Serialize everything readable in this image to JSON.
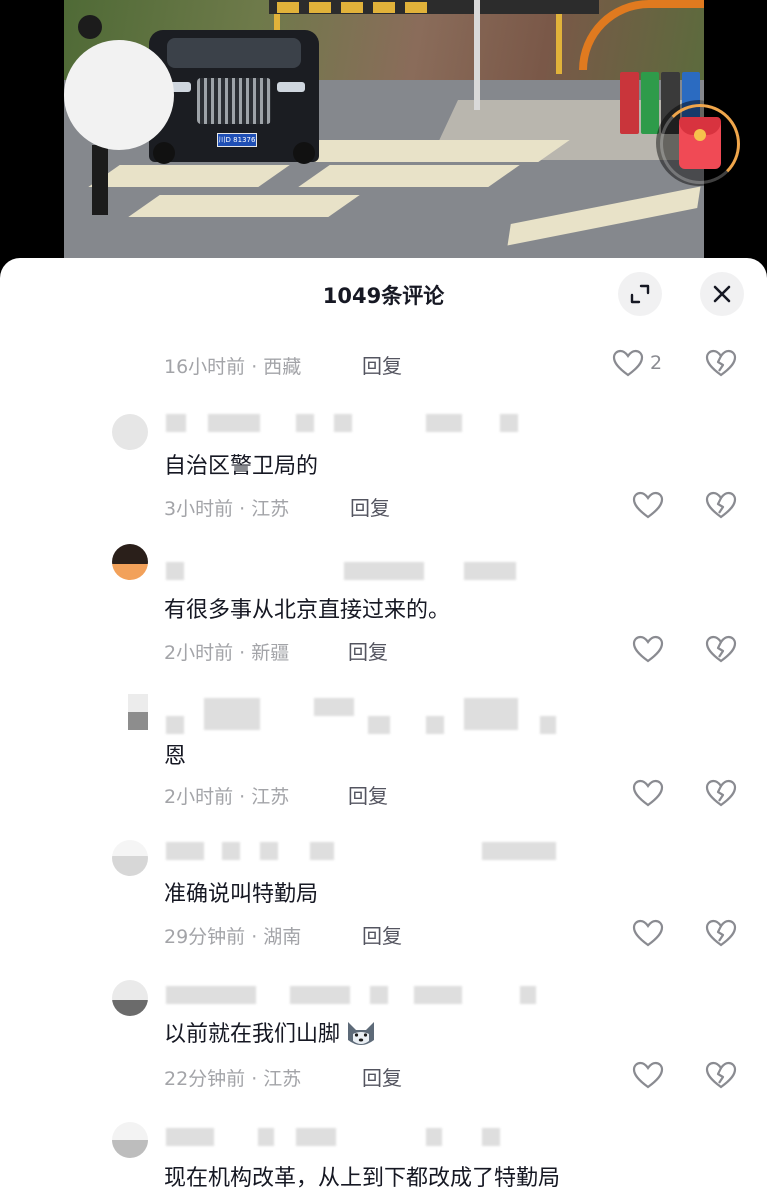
{
  "video": {
    "plate_text": "川D 81376"
  },
  "sheet": {
    "title": "1049条评论"
  },
  "comments": [
    {
      "text": "",
      "meta": "16小时前 · 西藏",
      "reply": "回复",
      "likes": "2"
    },
    {
      "text": "自治区警卫局的",
      "meta": "3小时前 · 江苏",
      "reply": "回复",
      "likes": ""
    },
    {
      "text": "有很多事从北京直接过来的。",
      "meta": "2小时前 · 新疆",
      "reply": "回复",
      "likes": ""
    },
    {
      "text": "恩",
      "meta": "2小时前 · 江苏",
      "reply": "回复",
      "likes": ""
    },
    {
      "text": "准确说叫特勤局",
      "meta": "29分钟前 · 湖南",
      "reply": "回复",
      "likes": ""
    },
    {
      "text": "以前就在我们山脚",
      "meta": "22分钟前 · 江苏",
      "reply": "回复",
      "likes": "",
      "emoji": "wolf-emoji"
    },
    {
      "text": "现在机构改革，从上到下都改成了特勤局",
      "meta": "",
      "reply": "",
      "likes": ""
    }
  ],
  "icons": {
    "like": "heart-outline-icon",
    "dislike": "broken-heart-icon",
    "expand": "expand-icon",
    "close": "close-icon",
    "redpacket": "red-packet-icon"
  }
}
